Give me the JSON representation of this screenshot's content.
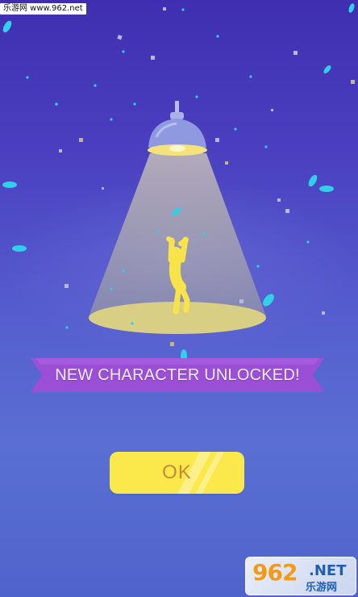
{
  "watermark": {
    "top_text": "乐游网 www.962.net",
    "bottom_number": "962",
    "bottom_suffix": ".NET",
    "bottom_cn": "乐游网"
  },
  "banner": {
    "text": "NEW CHARACTER UNLOCKED!"
  },
  "ok_button": {
    "label": "OK"
  },
  "colors": {
    "background_top": "#3f2fb0",
    "background_bottom": "#5a6fd3",
    "banner": "#9b4fd6",
    "button": "#fbe94c",
    "button_text": "#c58a37",
    "character": "#f8e44a",
    "spotlight": "#d8cf7a"
  },
  "icons": {
    "lamp": "ceiling-lamp-icon",
    "character": "dancing-character",
    "confetti": "confetti"
  }
}
